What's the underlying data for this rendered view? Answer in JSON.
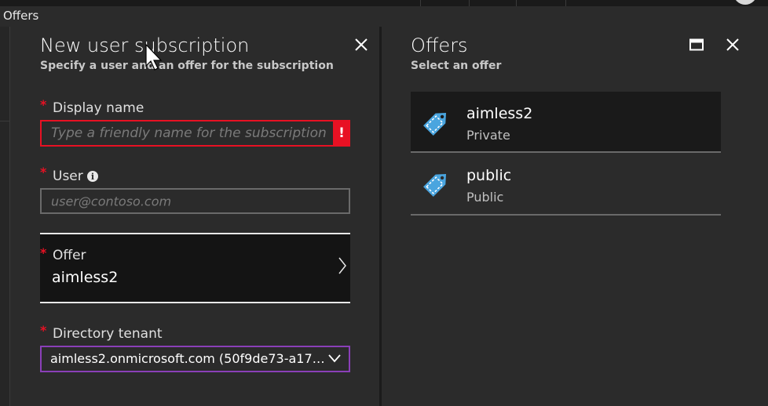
{
  "breadcrumb": "Offers",
  "left_blade": {
    "title": "New user subscription",
    "subtitle": "Specify a user and an offer for the subscription",
    "close_label": "✕",
    "fields": {
      "display_name": {
        "label": "Display name",
        "placeholder": "Type a friendly name for the subscription",
        "error_glyph": "!"
      },
      "user": {
        "label": "User",
        "info_glyph": "i",
        "placeholder": "user@contoso.com"
      },
      "offer": {
        "label": "Offer",
        "value": "aimless2"
      },
      "directory_tenant": {
        "label": "Directory tenant",
        "value": "aimless2.onmicrosoft.com (50f9de73-a175..."
      }
    },
    "required_marker": "*"
  },
  "right_blade": {
    "title": "Offers",
    "subtitle": "Select an offer",
    "offers": [
      {
        "name": "aimless2",
        "type": "Private",
        "icon": "tag-icon"
      },
      {
        "name": "public",
        "type": "Public",
        "icon": "tag-icon"
      }
    ]
  },
  "colors": {
    "background": "#2b2b2b",
    "error": "#e81123",
    "focus_border": "#8a3fb8",
    "tag_icon": "#4aa5df"
  }
}
